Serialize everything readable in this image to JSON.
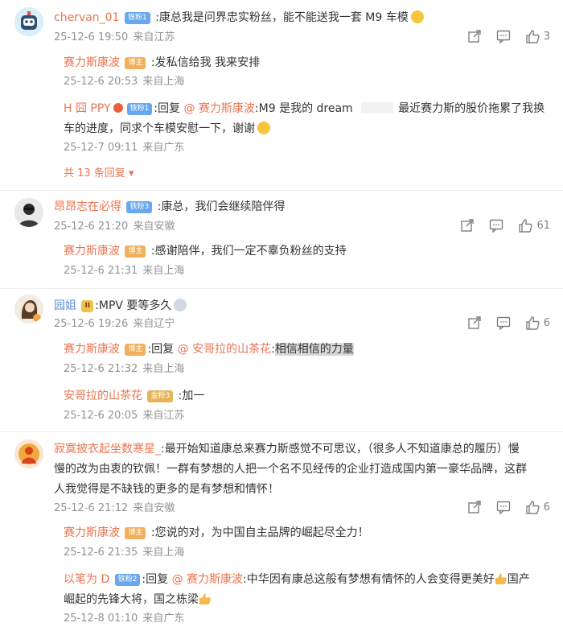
{
  "c1": {
    "user": "chervan_01",
    "badge": "铁粉1",
    "text": ":康总我是问界忠实粉丝，能不能送我一套 M9 车模",
    "date": "25-12-6 19:50",
    "loc": "来自江苏",
    "likes": "3",
    "replies": [
      {
        "user": "赛力斯康波",
        "badge": "博主",
        "text": ":发私信给我 我来安排",
        "date": "25-12-6 20:53",
        "loc": "来自上海"
      },
      {
        "user": "H 囧 PPY",
        "badge": "铁粉1",
        "prefix": ":回复",
        "mention": "@ 赛力斯康波",
        "text": ":M9 是我的 dream",
        "text2": "最近赛力斯的股价拖累了我换",
        "text3": "车的进度，同求个车模安慰一下，谢谢",
        "date": "25-12-7 09:11",
        "loc": "来自广东"
      }
    ],
    "more": "共 13 条回复"
  },
  "c2": {
    "user": "昂昂志在必得",
    "badge": "铁粉3",
    "text": ":康总，我们会继续陪伴得",
    "date": "25-12-6 21:20",
    "loc": "来自安徽",
    "likes": "61",
    "replies": [
      {
        "user": "赛力斯康波",
        "badge": "博主",
        "text": ":感谢陪伴，我们一定不辜负粉丝的支持",
        "date": "25-12-6 21:31",
        "loc": "来自上海"
      }
    ]
  },
  "c3": {
    "user": "园姐",
    "badge": "II",
    "text": ":MPV 要等多久",
    "date": "25-12-6 19:26",
    "loc": "来自辽宁",
    "likes": "6",
    "replies": [
      {
        "user": "赛力斯康波",
        "badge": "博主",
        "prefix": ":回复",
        "mention": "@ 安哥拉的山茶花",
        "text": ":",
        "highlight": "相信相信的力量",
        "date": "25-12-6 21:32",
        "loc": "来自上海"
      },
      {
        "user": "安哥拉的山茶花",
        "badge": "金粉3",
        "text": ":加一",
        "date": "25-12-6 20:05",
        "loc": "来自江苏"
      }
    ]
  },
  "c4": {
    "user": "寂寞披衣起坐数寒星_",
    "text1": ":最开始知道康总来赛力斯感觉不可思议，（很多人不知道康总的履历）慢",
    "text2": "慢的改为由衷的钦佩！一群有梦想的人把一个名不见经传的企业打造成国内第一豪华品牌，这群",
    "text3": "人我觉得是不缺钱的更多的是有梦想和情怀！",
    "date": "25-12-6 21:12",
    "loc": "来自安徽",
    "likes": "6",
    "replies": [
      {
        "user": "赛力斯康波",
        "badge": "博主",
        "text": ":您说的对，为中国自主品牌的崛起尽全力！",
        "date": "25-12-6 21:35",
        "loc": "来自上海"
      },
      {
        "user": "以笔为 D",
        "badge": "铁粉2",
        "prefix": ":回复",
        "mention": "@ 赛力斯康波",
        "text": ":中华因有康总这般有梦想有情怀的人会变得更美好",
        "text2": "国产",
        "text3": "崛起的先锋大将，国之栋梁",
        "date": "25-12-8 01:10",
        "loc": "来自广东"
      }
    ]
  },
  "colors": {
    "link": "#eb7350",
    "meta": "#939393",
    "text": "#333333"
  }
}
